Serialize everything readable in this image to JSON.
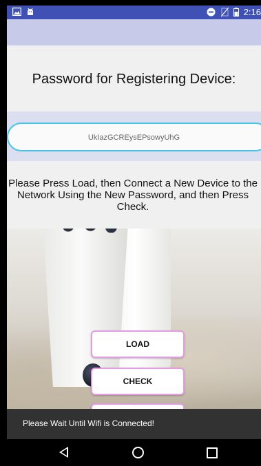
{
  "status_bar": {
    "time": "2:16",
    "icons": [
      "image-notification-icon",
      "android-notification-icon",
      "do-not-disturb-icon",
      "no-sim-icon",
      "battery-icon"
    ]
  },
  "screen": {
    "title": "Password for Registering Device:",
    "password_value": "UkIazGCREysEPsowyUhG",
    "instructions": "Please Press Load, then Connect a New Device to the Network Using the New Password, and  then Press Check."
  },
  "buttons": {
    "load_label": "LOAD",
    "check_label": "CHECK"
  },
  "toast": {
    "message": "Please Wait Until Wifi is Connected!"
  },
  "navigation": {
    "icons": [
      "back-icon",
      "home-icon",
      "recents-icon"
    ]
  },
  "colors": {
    "status_bar": "#3f51b5",
    "button_border": "#e79be6",
    "input_border": "#45c4ea",
    "toast_bg": "#323232"
  }
}
